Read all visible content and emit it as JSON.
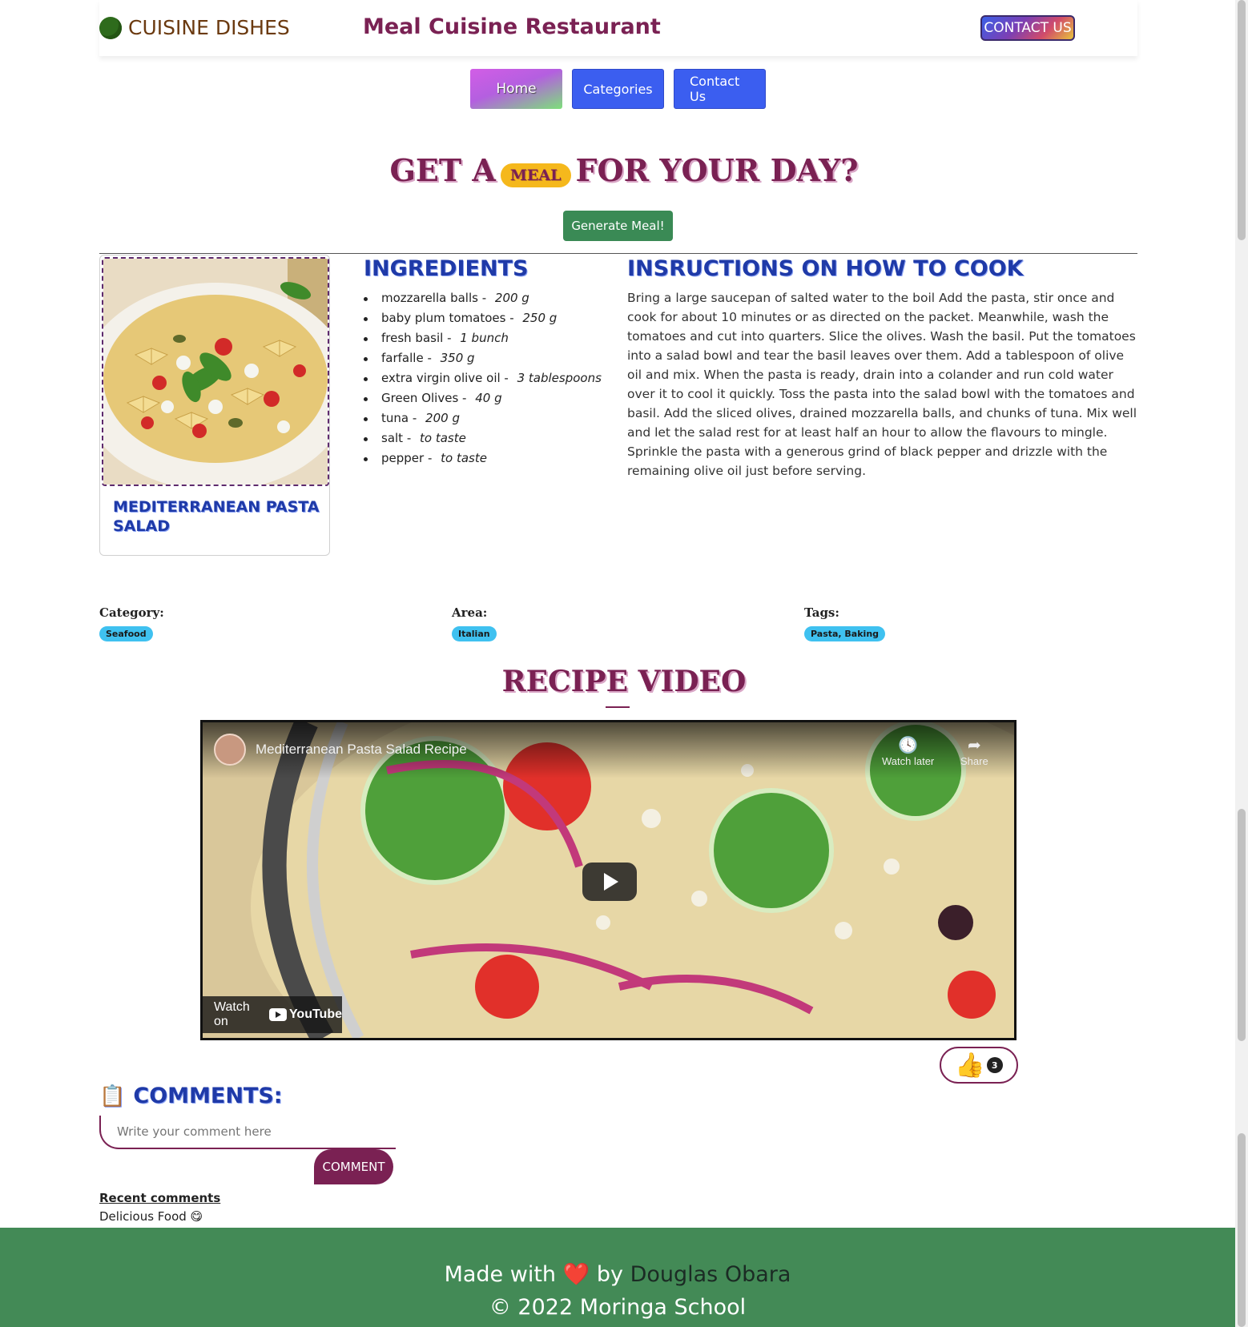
{
  "header": {
    "brand": "CUISINE DISHES",
    "site_title": "Meal Cuisine Restaurant",
    "contact_button": "CONTACT US"
  },
  "nav": {
    "items": [
      "Home",
      "Categories",
      "Contact Us"
    ]
  },
  "hero": {
    "prefix": "GET A",
    "pill": "MEAL",
    "suffix": "FOR YOUR DAY?",
    "generate_button": "Generate Meal!"
  },
  "meal": {
    "name": "MEDITERRANEAN PASTA SALAD",
    "ingredients_title": "INGREDIENTS",
    "ingredients": [
      {
        "name": "mozzarella balls - ",
        "qty": "200 g"
      },
      {
        "name": "baby plum tomatoes - ",
        "qty": "250 g"
      },
      {
        "name": "fresh basil - ",
        "qty": "1 bunch"
      },
      {
        "name": "farfalle - ",
        "qty": "350 g"
      },
      {
        "name": "extra virgin olive oil - ",
        "qty": "3 tablespoons"
      },
      {
        "name": "Green Olives - ",
        "qty": "40 g"
      },
      {
        "name": "tuna - ",
        "qty": "200 g"
      },
      {
        "name": "salt - ",
        "qty": "to taste"
      },
      {
        "name": "pepper - ",
        "qty": "to taste"
      }
    ],
    "instructions_title": "INSRUCTIONS ON HOW TO COOK",
    "instructions": "Bring a large saucepan of salted water to the boil Add the pasta, stir once and cook for about 10 minutes or as directed on the packet. Meanwhile, wash the tomatoes and cut into quarters. Slice the olives. Wash the basil. Put the tomatoes into a salad bowl and tear the basil leaves over them. Add a tablespoon of olive oil and mix. When the pasta is ready, drain into a colander and run cold water over it to cool it quickly. Toss the pasta into the salad bowl with the tomatoes and basil. Add the sliced olives, drained mozzarella balls, and chunks of tuna. Mix well and let the salad rest for at least half an hour to allow the flavours to mingle. Sprinkle the pasta with a generous grind of black pepper and drizzle with the remaining olive oil just before serving."
  },
  "meta": {
    "category_label": "Category:",
    "category": "Seafood",
    "area_label": "Area:",
    "area": "Italian",
    "tags_label": "Tags:",
    "tags": "Pasta, Baking"
  },
  "video": {
    "section_title": "RECIPE VIDEO",
    "title": "Mediterranean Pasta Salad Recipe",
    "watch_later": "Watch later",
    "share": "Share",
    "watch_on": "Watch on",
    "youtube": "YouTube"
  },
  "likes": {
    "icon": "👍",
    "count": "3"
  },
  "comments": {
    "title": "COMMENTS:",
    "icon": "📋",
    "placeholder": "Write your comment here",
    "button": "COMMENT",
    "recent_title": "Recent comments",
    "recent": [
      "Delicious Food 😋"
    ]
  },
  "footer": {
    "made_with": "Made with",
    "heart": "❤️",
    "by": "by",
    "author": "Douglas Obara",
    "copyright": "© 2022 Moringa School"
  }
}
